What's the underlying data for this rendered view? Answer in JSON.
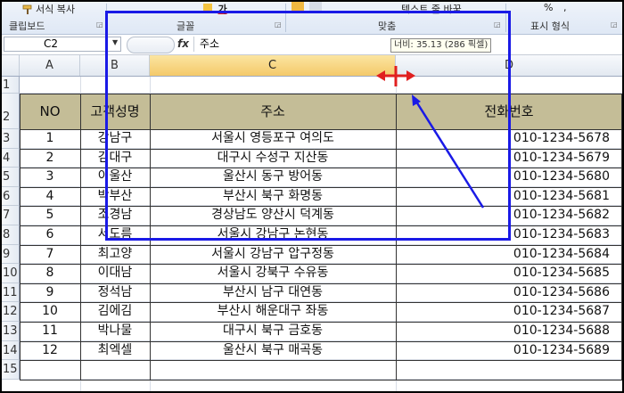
{
  "ribbon": {
    "top_items": [
      "서식 복사",
      "가",
      "가",
      "가"
    ],
    "groups": [
      {
        "label": "클립보드"
      },
      {
        "label": "글꼴"
      },
      {
        "label": "맞춤"
      },
      {
        "label": "표시 형식"
      }
    ],
    "wrap_label": "텍스트 줄 바꿈",
    "pct": "%",
    "comma": ","
  },
  "formula_bar": {
    "name_box": "C2",
    "fx": "fx",
    "value": "주소"
  },
  "tooltip": "너비: 35.13 (286 픽셀)",
  "columns": [
    "A",
    "B",
    "C",
    "D"
  ],
  "rows": [
    "1",
    "2",
    "3",
    "4",
    "5",
    "6",
    "7",
    "8",
    "9",
    "10",
    "11",
    "12",
    "13",
    "14",
    "15"
  ],
  "table": {
    "headers": [
      "NO",
      "고객성명",
      "주소",
      "전화번호"
    ],
    "records": [
      {
        "no": "1",
        "name": "강남구",
        "addr": "서울시 영등포구 여의도",
        "phone": "010-1234-5678"
      },
      {
        "no": "2",
        "name": "김대구",
        "addr": "대구시 수성구 지산동",
        "phone": "010-1234-5679"
      },
      {
        "no": "3",
        "name": "이울산",
        "addr": "울산시 동구 방어동",
        "phone": "010-1234-5680"
      },
      {
        "no": "4",
        "name": "박부산",
        "addr": "부산시 북구 화명동",
        "phone": "010-1234-5681"
      },
      {
        "no": "5",
        "name": "조경남",
        "addr": "경상남도 양산시 덕계동",
        "phone": "010-1234-5682"
      },
      {
        "no": "6",
        "name": "서도름",
        "addr": "서울시 강남구 논현동",
        "phone": "010-1234-5683"
      },
      {
        "no": "7",
        "name": "최고양",
        "addr": "서울시 강남구 압구정동",
        "phone": "010-1234-5684"
      },
      {
        "no": "8",
        "name": "이대남",
        "addr": "서울시 강북구 수유동",
        "phone": "010-1234-5685"
      },
      {
        "no": "9",
        "name": "정석남",
        "addr": "부산시 남구 대연동",
        "phone": "010-1234-5686"
      },
      {
        "no": "10",
        "name": "김에김",
        "addr": "부산시 해운대구 좌동",
        "phone": "010-1234-5687"
      },
      {
        "no": "11",
        "name": "박나물",
        "addr": "대구시 북구 금호동",
        "phone": "010-1234-5688"
      },
      {
        "no": "12",
        "name": "최엑셀",
        "addr": "울산시 북구 매곡동",
        "phone": "010-1234-5689"
      }
    ]
  },
  "colors": {
    "header_fill": "#c4bd97",
    "selected_col": "#f4c96a",
    "annotation_blue": "#1a1ae6",
    "annotation_red": "#e02020"
  }
}
